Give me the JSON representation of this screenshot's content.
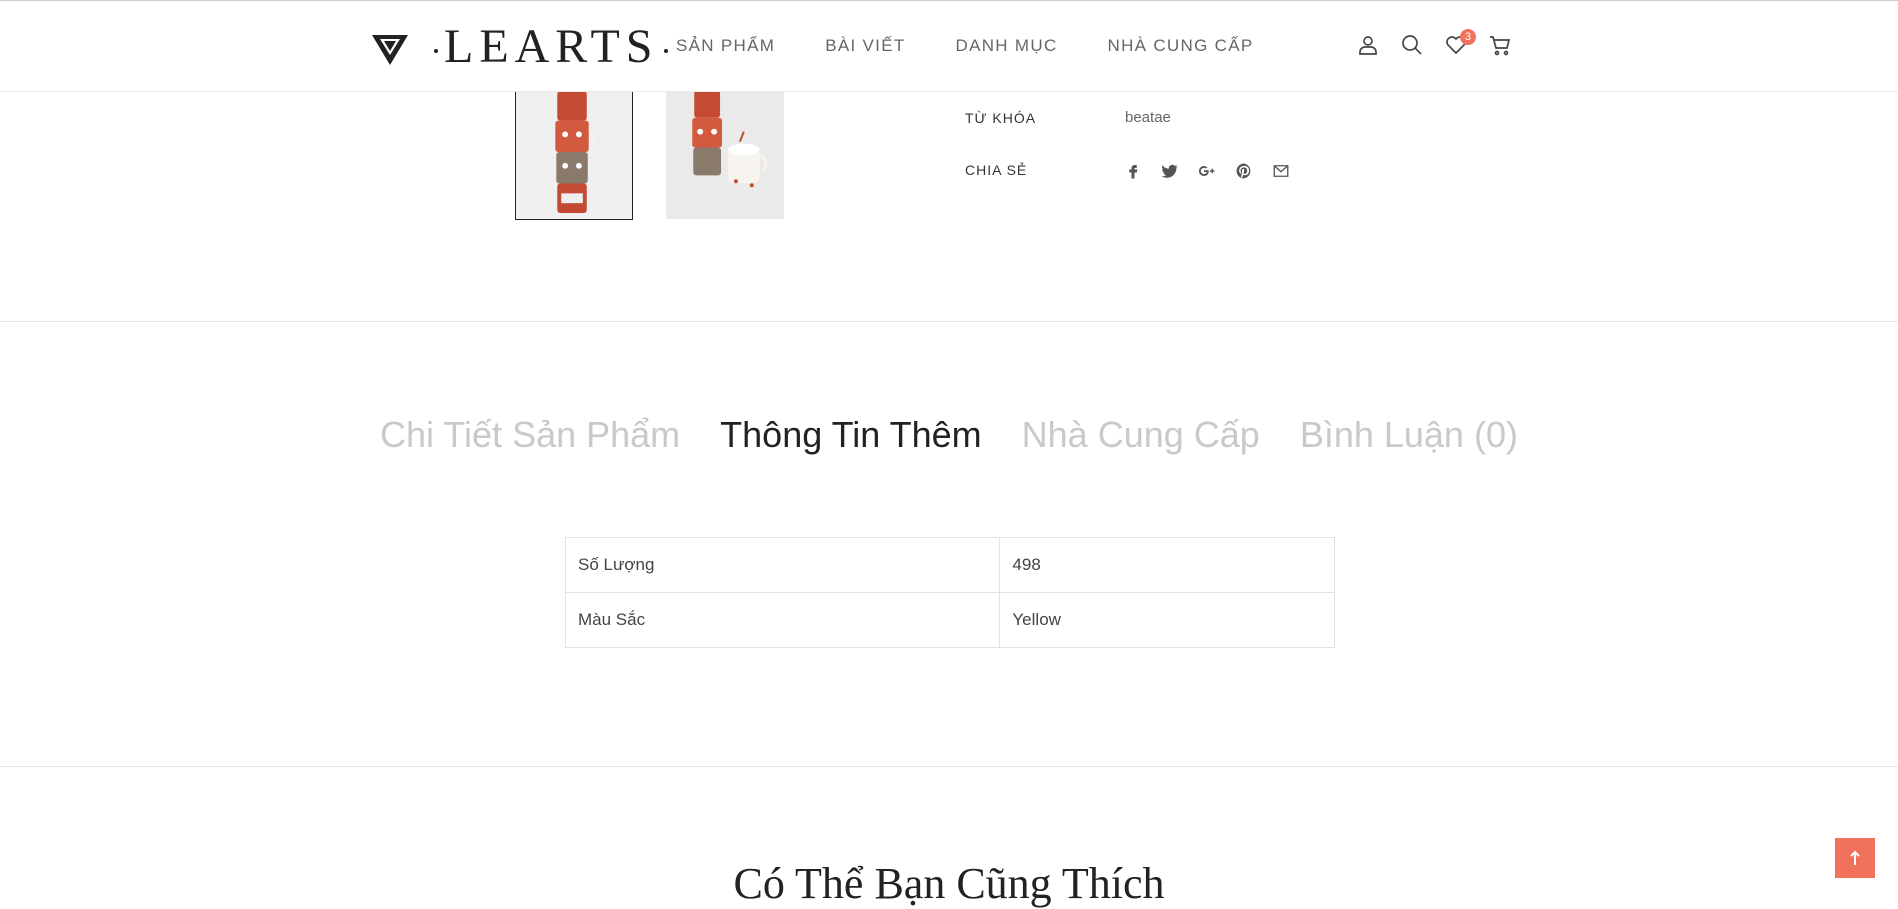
{
  "header": {
    "logo_text": "LEARTS",
    "nav": [
      "SẢN PHẨM",
      "BÀI VIẾT",
      "DANH MỤC",
      "NHÀ CUNG CẤP"
    ],
    "icons": [
      "user-icon",
      "search-icon",
      "heart-icon",
      "cart-icon"
    ],
    "wishlist_count": "3"
  },
  "product_meta": {
    "tags_label": "TỪ KHÓA",
    "tags_value": "beatae",
    "share_label": "CHIA SẺ",
    "share_icons": [
      "facebook-icon",
      "twitter-icon",
      "google-plus-icon",
      "pinterest-icon",
      "email-icon"
    ]
  },
  "tabs": [
    {
      "label": "Chi Tiết Sản Phẩm",
      "active": false
    },
    {
      "label": "Thông Tin Thêm",
      "active": true
    },
    {
      "label": "Nhà Cung Cấp",
      "active": false
    },
    {
      "label": "Bình Luận (0)",
      "active": false
    }
  ],
  "info_table": [
    {
      "label": "Số Lượng",
      "value": "498"
    },
    {
      "label": "Màu Sắc",
      "value": "Yellow"
    }
  ],
  "related_title": "Có Thể Bạn Cũng Thích",
  "colors": {
    "accent": "#f0715c",
    "tab_inactive": "#c9c9c9",
    "text_dark": "#222222"
  }
}
